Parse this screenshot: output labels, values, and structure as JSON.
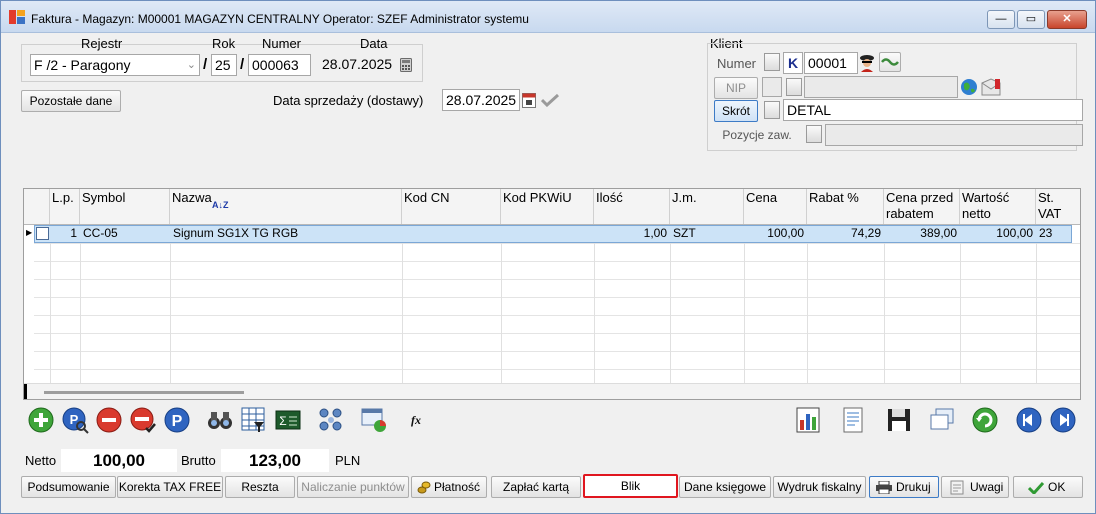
{
  "window": {
    "title": "Faktura - Magazyn: M00001 MAGAZYN CENTRALNY  Operator: SZEF Administrator systemu",
    "minimize_label": "—",
    "maximize_label": "▭",
    "close_label": "✕"
  },
  "document": {
    "rejestr_label": "Rejestr",
    "rok_label": "Rok",
    "numer_label": "Numer",
    "data_label": "Data",
    "rejestr_value": "F /2   - Paragony",
    "rok_value": "25",
    "numer_value": "000063",
    "data_value": "28.07.2025",
    "slash": "/",
    "pozostale_button": "Pozostałe dane",
    "data_sprzedazy_label": "Data sprzedaży (dostawy)",
    "data_sprzedazy_value": "28.07.2025"
  },
  "client": {
    "title": "Klient",
    "numer_label": "Numer",
    "k_label": "K",
    "numer_value": "00001",
    "nip_label": "NIP",
    "nip_value": "",
    "skrot_label": "Skrót",
    "skrot_value": "DETAL",
    "pozycje_label": "Pozycje zaw.",
    "pozycje_value": ""
  },
  "table": {
    "columns": [
      "L.p.",
      "Symbol",
      "Nazwa",
      "Kod  CN",
      "Kod  PKWiU",
      "Ilość",
      "J.m.",
      "Cena",
      "Rabat %",
      "Cena przed rabatem",
      "Wartość netto",
      "St. VAT"
    ],
    "sort_glyph": "A↓Z",
    "rows": [
      {
        "lp": "1",
        "symbol": "CC-05",
        "nazwa": "Signum SG1X TG RGB",
        "kod_cn": "",
        "kod_pkwiu": "",
        "ilosc": "1,00",
        "jm": "SZT",
        "cena": "100,00",
        "rabat": "74,29",
        "cena_przed": "389,00",
        "wartosc": "100,00",
        "vat": "23"
      }
    ]
  },
  "toolbar_icons": [
    "add-icon",
    "preview-icon",
    "delete-icon",
    "remove-position-icon",
    "parking-icon",
    "binoculars-icon",
    "grid-filter-icon",
    "sum-icon",
    "network-icon",
    "export-icon",
    "formula-icon",
    "chart-icon",
    "document-icon",
    "save-icon",
    "copy-icon",
    "refresh-icon",
    "first-record-icon",
    "last-record-icon"
  ],
  "totals": {
    "netto_label": "Netto",
    "netto_value": "100,00",
    "brutto_label": "Brutto",
    "brutto_value": "123,00",
    "currency": "PLN"
  },
  "buttons": {
    "podsumowanie": "Podsumowanie",
    "korekta": "Korekta TAX FREE",
    "reszta": "Reszta",
    "naliczanie": "Naliczanie punktów",
    "platnosc": "Płatność",
    "zaplac_karta": "Zapłać kartą",
    "blik": "Blik",
    "dane_ksiegowe": "Dane księgowe",
    "wydruk_fiskalny": "Wydruk fiskalny",
    "drukuj": "Drukuj",
    "uwagi": "Uwagi",
    "ok": "OK"
  },
  "colors": {
    "selected_row": "#cce3f7",
    "highlight_border": "#e0161f",
    "accent_blue": "#2a6fc4"
  }
}
